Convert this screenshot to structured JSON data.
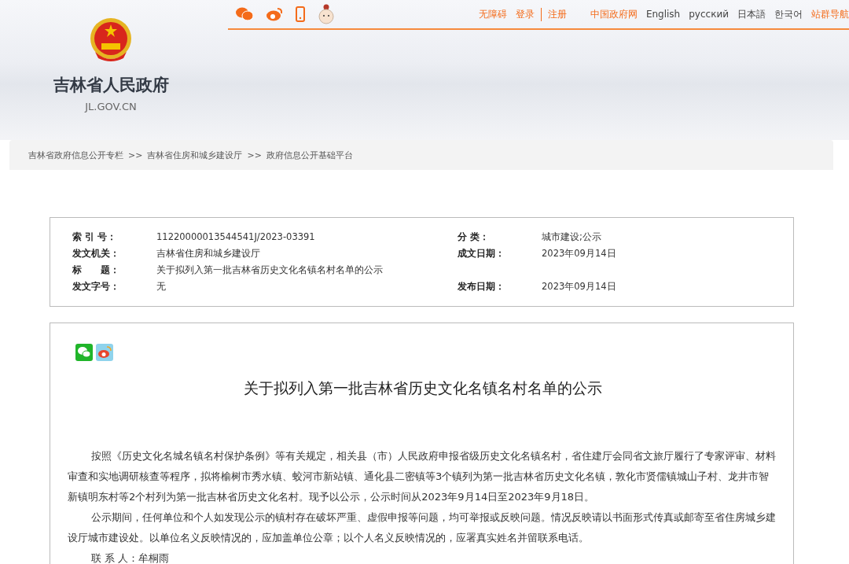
{
  "site": {
    "name": "吉林省人民政府",
    "domain": "JL.GOV.CN"
  },
  "top_links": [
    {
      "label": "无障碍",
      "highlighted": true
    },
    {
      "label": "登录",
      "highlighted": true
    },
    {
      "label": "注册",
      "highlighted": true
    },
    {
      "label": "中国政府网",
      "highlighted": true
    },
    {
      "label": "English",
      "highlighted": false
    },
    {
      "label": "русский",
      "highlighted": false
    },
    {
      "label": "日本語",
      "highlighted": false
    },
    {
      "label": "한국어",
      "highlighted": false
    },
    {
      "label": "站群导航",
      "highlighted": true
    }
  ],
  "breadcrumb": [
    "吉林省政府信息公开专栏",
    "吉林省住房和城乡建设厅",
    "政府信息公开基础平台"
  ],
  "breadcrumb_separator": ">>",
  "info": [
    {
      "label": "索 引 号：",
      "value": "11220000013544541J/2023-03391",
      "label2": "分 类：",
      "value2": "城市建设;公示"
    },
    {
      "label": "发文机关：",
      "value": "吉林省住房和城乡建设厅",
      "label2": "成文日期：",
      "value2": "2023年09月14日"
    },
    {
      "label": "标　　题：",
      "value": "关于拟列入第一批吉林省历史文化名镇名村名单的公示"
    },
    {
      "label": "发文字号：",
      "value": "无",
      "label2": "发布日期：",
      "value2": "2023年09月14日"
    }
  ],
  "article": {
    "title": "关于拟列入第一批吉林省历史文化名镇名村名单的公示",
    "paragraphs": [
      "按照《历史文化名城名镇名村保护条例》等有关规定，相关县（市）人民政府申报省级历史文化名镇名村，省住建厅会同省文旅厅履行了专家评审、材料审查和实地调研核查等程序，拟将榆树市秀水镇、蛟河市新站镇、通化县二密镇等3个镇列为第一批吉林省历史文化名镇，敦化市贤儒镇城山子村、龙井市智新镇明东村等2个村列为第一批吉林省历史文化名村。现予以公示，公示时间从2023年9月14日至2023年9月18日。",
      "公示期间，任何单位和个人如发现公示的镇村存在破坏严重、虚假申报等问题，均可举报或反映问题。情况反映请以书面形式传真或邮寄至省住房城乡建设厅城市建设处。以单位名义反映情况的，应加盖单位公章；以个人名义反映情况的，应署真实姓名并留联系电话。",
      "联 系 人：牟桐雨"
    ]
  }
}
